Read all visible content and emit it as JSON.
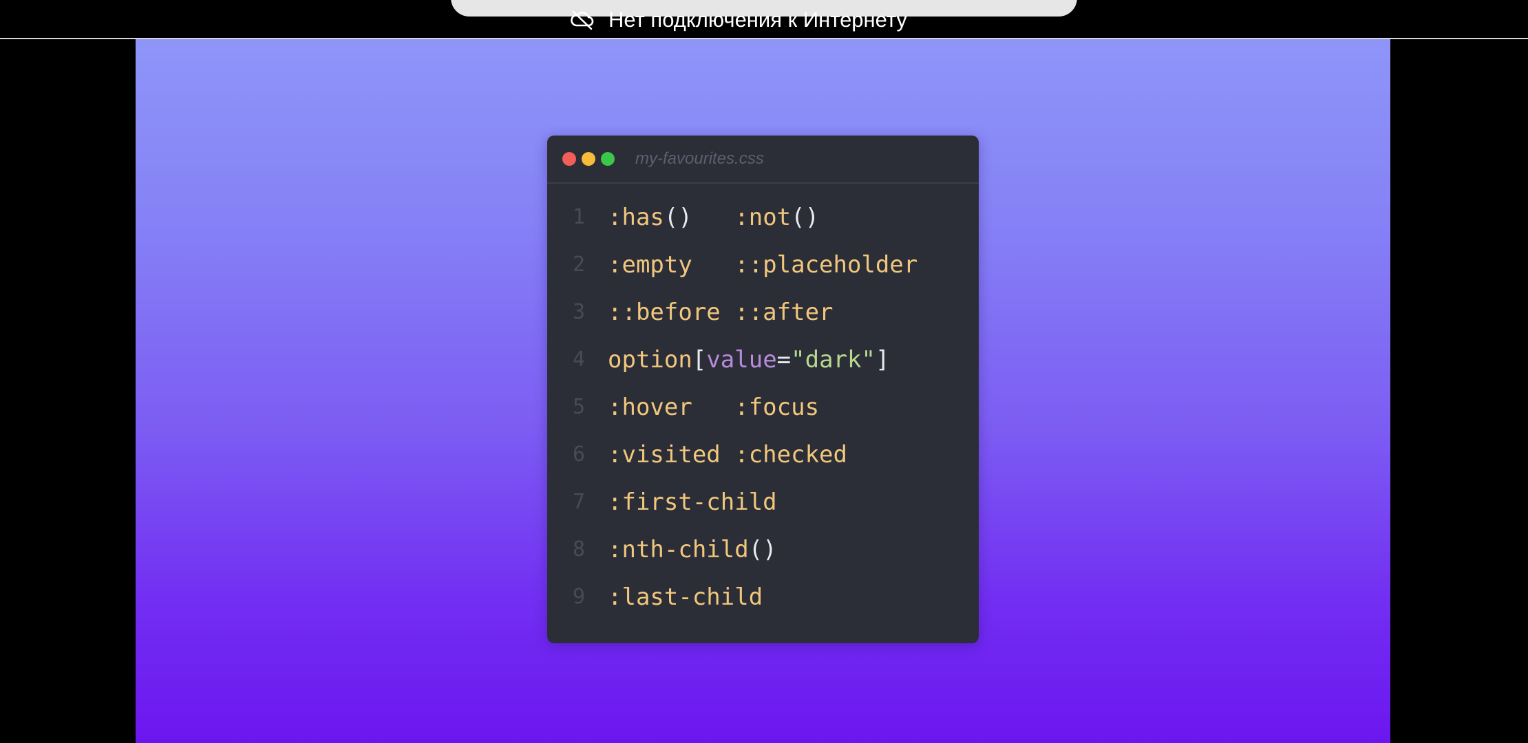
{
  "status": {
    "connection_text": "Нет подключения к Интернету",
    "icon": "cloud-off-icon"
  },
  "editor": {
    "filename": "my-favourites.css",
    "traffic_lights": [
      "#f25f58",
      "#f8bc3b",
      "#3ac74a"
    ],
    "lines": [
      {
        "number": "1",
        "tokens": [
          {
            "text": ":has",
            "kind": "selector"
          },
          {
            "text": "()",
            "kind": "paren"
          },
          {
            "text": "   ",
            "kind": "paren"
          },
          {
            "text": ":not",
            "kind": "selector"
          },
          {
            "text": "()",
            "kind": "paren"
          }
        ]
      },
      {
        "number": "2",
        "tokens": [
          {
            "text": ":empty   ",
            "kind": "selector"
          },
          {
            "text": "::placeholder",
            "kind": "selector"
          }
        ]
      },
      {
        "number": "3",
        "tokens": [
          {
            "text": "::before ",
            "kind": "selector"
          },
          {
            "text": "::after",
            "kind": "selector"
          }
        ]
      },
      {
        "number": "4",
        "tokens": [
          {
            "text": "option",
            "kind": "selector"
          },
          {
            "text": "[",
            "kind": "paren"
          },
          {
            "text": "value",
            "kind": "attr"
          },
          {
            "text": "=",
            "kind": "op"
          },
          {
            "text": "\"dark\"",
            "kind": "string"
          },
          {
            "text": "]",
            "kind": "paren"
          }
        ]
      },
      {
        "number": "5",
        "tokens": [
          {
            "text": ":hover   ",
            "kind": "selector"
          },
          {
            "text": ":focus",
            "kind": "selector"
          }
        ]
      },
      {
        "number": "6",
        "tokens": [
          {
            "text": ":visited ",
            "kind": "selector"
          },
          {
            "text": ":checked",
            "kind": "selector"
          }
        ]
      },
      {
        "number": "7",
        "tokens": [
          {
            "text": ":first-child",
            "kind": "selector"
          }
        ]
      },
      {
        "number": "8",
        "tokens": [
          {
            "text": ":nth-child",
            "kind": "selector"
          },
          {
            "text": "()",
            "kind": "paren"
          }
        ]
      },
      {
        "number": "9",
        "tokens": [
          {
            "text": ":last-child",
            "kind": "selector"
          }
        ]
      }
    ]
  }
}
